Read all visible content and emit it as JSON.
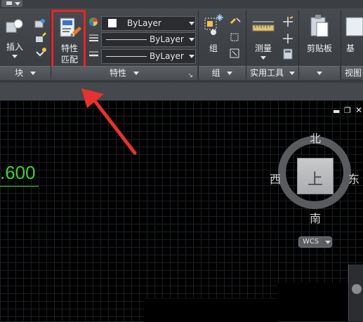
{
  "ribbon": {
    "panels": {
      "block": {
        "insert_label": "插入",
        "title": "块"
      },
      "match_properties": {
        "label_line1": "特性",
        "label_line2": "匹配"
      },
      "properties": {
        "title": "特性",
        "color_value": "ByLayer",
        "linetype_value": "ByLayer",
        "lineweight_value": "ByLayer"
      },
      "groups": {
        "button_label": "组",
        "title": "组"
      },
      "utilities": {
        "measure_label": "测量",
        "title": "实用工具"
      },
      "clipboard": {
        "paste_label": "剪贴板"
      },
      "view": {
        "title": "视图",
        "base_label": "基"
      }
    }
  },
  "canvas": {
    "dimension_text": ".600",
    "viewcube": {
      "north": "北",
      "south": "南",
      "east": "东",
      "west": "西",
      "top_face": "上",
      "ucs_label": "WCS"
    }
  },
  "colors": {
    "highlight_box": "#e8242b",
    "arrow": "#e8322f",
    "dimension_text": "#3fcf3a",
    "ribbon_bg": "#3d4045",
    "canvas_bg": "#000000"
  }
}
